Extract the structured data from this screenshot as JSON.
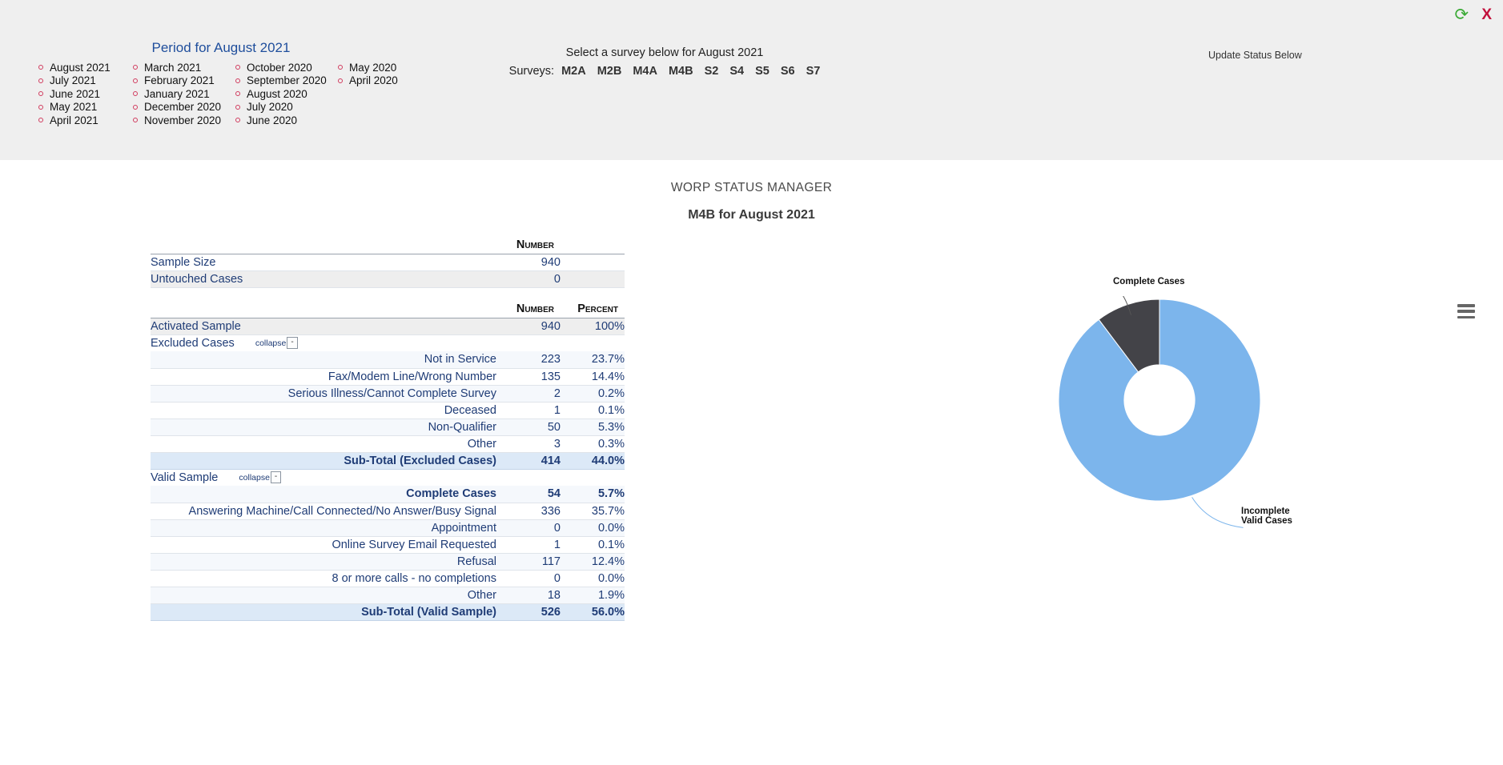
{
  "window": {
    "refresh_icon": "refresh-icon",
    "close_icon": "close-icon",
    "close_label": "X"
  },
  "period": {
    "title": "Period for August 2021",
    "columns": [
      [
        "August 2021",
        "July 2021",
        "June 2021",
        "May 2021",
        "April 2021"
      ],
      [
        "March 2021",
        "February 2021",
        "January 2021",
        "December 2020",
        "November 2020"
      ],
      [
        "October 2020",
        "September 2020",
        "August 2020",
        "July 2020",
        "June 2020"
      ],
      [
        "May 2020",
        "April 2020"
      ]
    ]
  },
  "survey": {
    "prompt": "Select a survey below for August 2021",
    "label": "Surveys:",
    "options": [
      "M2A",
      "M2B",
      "M4A",
      "M4B",
      "S2",
      "S4",
      "S5",
      "S6",
      "S7"
    ],
    "selected": "M4B"
  },
  "update_status": "Update Status Below",
  "titles": {
    "app": "WORP STATUS MANAGER",
    "report": "M4B for August 2021"
  },
  "summary_table": {
    "headers": {
      "label": "",
      "number": "Number"
    },
    "rows": [
      {
        "label": "Sample Size",
        "number": "940"
      },
      {
        "label": "Untouched Cases",
        "number": "0"
      }
    ]
  },
  "detail_table": {
    "headers": {
      "label": "",
      "number": "Number",
      "percent": "Percent"
    },
    "activated": {
      "label": "Activated Sample",
      "number": "940",
      "percent": "100%"
    },
    "excluded_section": {
      "label": "Excluded Cases",
      "collapse_word": "collapse",
      "collapse_btn": "-"
    },
    "excluded_rows": [
      {
        "label": "Not in Service",
        "number": "223",
        "percent": "23.7%"
      },
      {
        "label": "Fax/Modem Line/Wrong Number",
        "number": "135",
        "percent": "14.4%"
      },
      {
        "label": "Serious Illness/Cannot Complete Survey",
        "number": "2",
        "percent": "0.2%"
      },
      {
        "label": "Deceased",
        "number": "1",
        "percent": "0.1%"
      },
      {
        "label": "Non-Qualifier",
        "number": "50",
        "percent": "5.3%"
      },
      {
        "label": "Other",
        "number": "3",
        "percent": "0.3%"
      }
    ],
    "excluded_subtotal": {
      "label": "Sub-Total (Excluded Cases)",
      "number": "414",
      "percent": "44.0%"
    },
    "valid_section": {
      "label": "Valid Sample",
      "collapse_word": "collapse",
      "collapse_btn": "-"
    },
    "valid_rows": [
      {
        "label": "Complete Cases",
        "number": "54",
        "percent": "5.7%"
      },
      {
        "label": "Answering Machine/Call Connected/No Answer/Busy Signal",
        "number": "336",
        "percent": "35.7%"
      },
      {
        "label": "Appointment",
        "number": "0",
        "percent": "0.0%"
      },
      {
        "label": "Online Survey Email Requested",
        "number": "1",
        "percent": "0.1%"
      },
      {
        "label": "Refusal",
        "number": "117",
        "percent": "12.4%"
      },
      {
        "label": "8 or more calls - no completions",
        "number": "0",
        "percent": "0.0%"
      },
      {
        "label": "Other",
        "number": "18",
        "percent": "1.9%"
      }
    ],
    "valid_subtotal": {
      "label": "Sub-Total (Valid Sample)",
      "number": "526",
      "percent": "56.0%"
    }
  },
  "chart_data": {
    "type": "pie",
    "variant": "donut",
    "title": "",
    "categories": [
      "Complete Cases",
      "Incomplete Valid Cases"
    ],
    "values": [
      54,
      472
    ],
    "percentages": [
      10.3,
      89.7
    ],
    "colors": [
      "#434348",
      "#7cb5ec"
    ],
    "labels": {
      "complete": "Complete Cases",
      "incomplete_line1": "Incomplete",
      "incomplete_line2": "Valid Cases"
    },
    "legend": "none",
    "inner_radius_pct": 35,
    "menu_icon": "hamburger-menu-icon"
  }
}
